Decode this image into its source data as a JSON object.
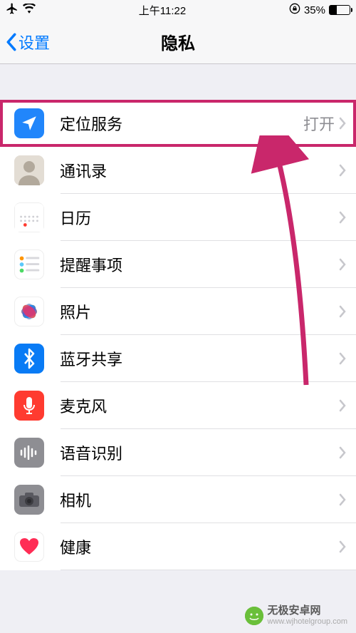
{
  "status": {
    "time": "上午11:22",
    "battery_pct": "35%"
  },
  "nav": {
    "back_label": "设置",
    "title": "隐私"
  },
  "rows": {
    "location": {
      "label": "定位服务",
      "value": "打开"
    },
    "contacts": {
      "label": "通讯录"
    },
    "calendar": {
      "label": "日历"
    },
    "reminders": {
      "label": "提醒事项"
    },
    "photos": {
      "label": "照片"
    },
    "bluetooth": {
      "label": "蓝牙共享"
    },
    "microphone": {
      "label": "麦克风"
    },
    "speech": {
      "label": "语音识别"
    },
    "camera": {
      "label": "相机"
    },
    "health": {
      "label": "健康"
    }
  },
  "watermark": {
    "title": "无极安卓网",
    "url": "www.wjhotelgroup.com"
  }
}
